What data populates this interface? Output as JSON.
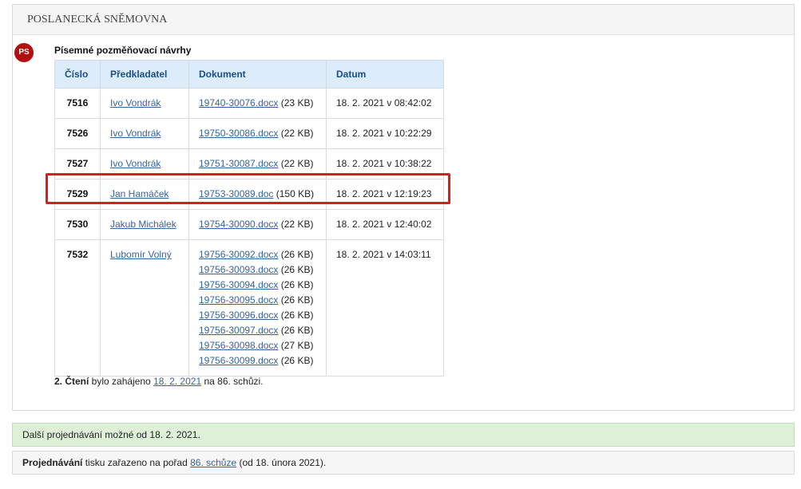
{
  "panel": {
    "header": "POSLANECKÁ SNĚMOVNA",
    "badge": "PS",
    "section_title": "Písemné pozměňovací návrhy"
  },
  "table": {
    "headers": [
      "Číslo",
      "Předkladatel",
      "Dokument",
      "Datum"
    ],
    "rows": [
      {
        "num": "7516",
        "submitter": "Ivo Vondrák",
        "docs": [
          {
            "name": "19740-30076.docx",
            "size": "(23 KB)"
          }
        ],
        "date": "18. 2. 2021 v 08:42:02"
      },
      {
        "num": "7526",
        "submitter": "Ivo Vondrák",
        "docs": [
          {
            "name": "19750-30086.docx",
            "size": "(22 KB)"
          }
        ],
        "date": "18. 2. 2021 v 10:22:29"
      },
      {
        "num": "7527",
        "submitter": "Ivo Vondrák",
        "docs": [
          {
            "name": "19751-30087.docx",
            "size": "(22 KB)"
          }
        ],
        "date": "18. 2. 2021 v 10:38:22"
      },
      {
        "num": "7529",
        "submitter": "Jan Hamáček",
        "docs": [
          {
            "name": "19753-30089.doc",
            "size": "(150 KB)"
          }
        ],
        "date": "18. 2. 2021 v 12:19:23"
      },
      {
        "num": "7530",
        "submitter": "Jakub Michálek",
        "docs": [
          {
            "name": "19754-30090.docx",
            "size": "(22 KB)"
          }
        ],
        "date": "18. 2. 2021 v 12:40:02"
      },
      {
        "num": "7532",
        "submitter": "Lubomír Volný",
        "docs": [
          {
            "name": "19756-30092.docx",
            "size": "(26 KB)"
          },
          {
            "name": "19756-30093.docx",
            "size": "(26 KB)"
          },
          {
            "name": "19756-30094.docx",
            "size": "(26 KB)"
          },
          {
            "name": "19756-30095.docx",
            "size": "(26 KB)"
          },
          {
            "name": "19756-30096.docx",
            "size": "(26 KB)"
          },
          {
            "name": "19756-30097.docx",
            "size": "(26 KB)"
          },
          {
            "name": "19756-30098.docx",
            "size": "(27 KB)"
          },
          {
            "name": "19756-30099.docx",
            "size": "(26 KB)"
          }
        ],
        "date": "18. 2. 2021 v 14:03:11"
      }
    ]
  },
  "reading": {
    "bold": "2. Čtení",
    "text_before": " bylo zahájeno ",
    "link": "18. 2. 2021",
    "text_after": " na 86. schůzi."
  },
  "info_green": "Další projednávání možné od 18. 2. 2021.",
  "info_gray": {
    "bold": "Projednávání",
    "text_before": " tisku zařazeno na pořad ",
    "link": "86. schůze",
    "text_after": " (od 18. února 2021)."
  },
  "colors": {
    "badge": "#b40e0e",
    "header_bg": "#dcecfb",
    "link": "#35649c",
    "highlight": "#e01b1b",
    "info_green_bg": "#dff0d8"
  }
}
